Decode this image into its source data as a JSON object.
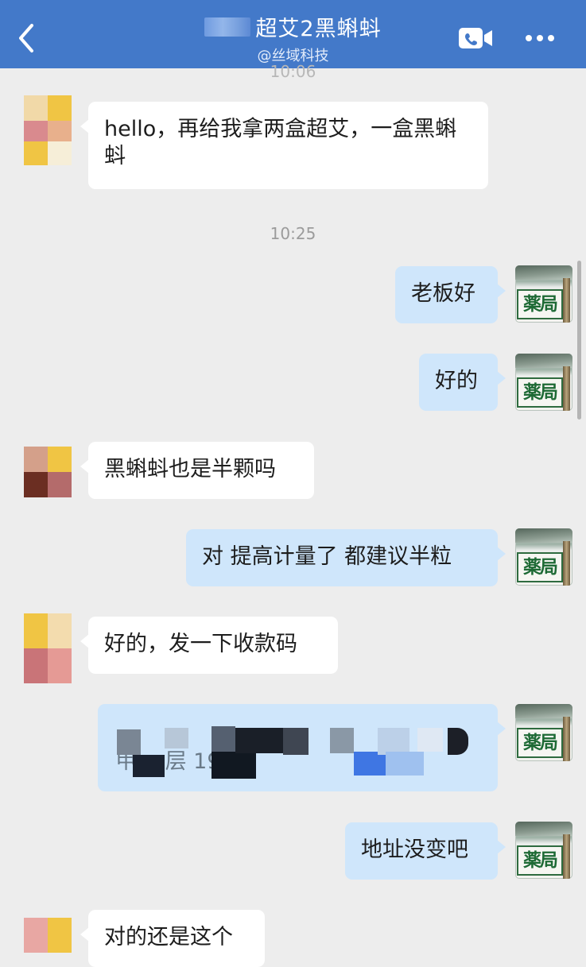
{
  "header": {
    "title": "超艾2黑蝌蚪",
    "subtitle": "@丝域科技",
    "back_icon": "chevron-left-icon",
    "call_icon": "video-call-icon",
    "more_icon": "more-dots-icon"
  },
  "timestamps": {
    "ghost": "10:06",
    "t1": "10:25"
  },
  "messages": [
    {
      "side": "in",
      "text": "hello，再给我拿两盒超艾，一盒黑蝌蚪"
    },
    {
      "side": "out",
      "text": "老板好"
    },
    {
      "side": "out",
      "text": "好的"
    },
    {
      "side": "in",
      "text": "黑蝌蚪也是半颗吗"
    },
    {
      "side": "out",
      "text": "对 提高计量了 都建议半粒"
    },
    {
      "side": "in",
      "text": "好的，发一下收款码"
    },
    {
      "side": "out",
      "text": "甲 一层 19 34",
      "redacted": true
    },
    {
      "side": "out",
      "text": "地址没变吧"
    },
    {
      "side": "in",
      "text": "对的还是这个"
    }
  ],
  "avatar_out_label": "薬局",
  "colors": {
    "header_bg": "#4379c9",
    "chat_bg": "#ededed",
    "bubble_out": "#cfe6fb",
    "bubble_in": "#ffffff",
    "pharmacy_sign": "#1e6a35"
  }
}
